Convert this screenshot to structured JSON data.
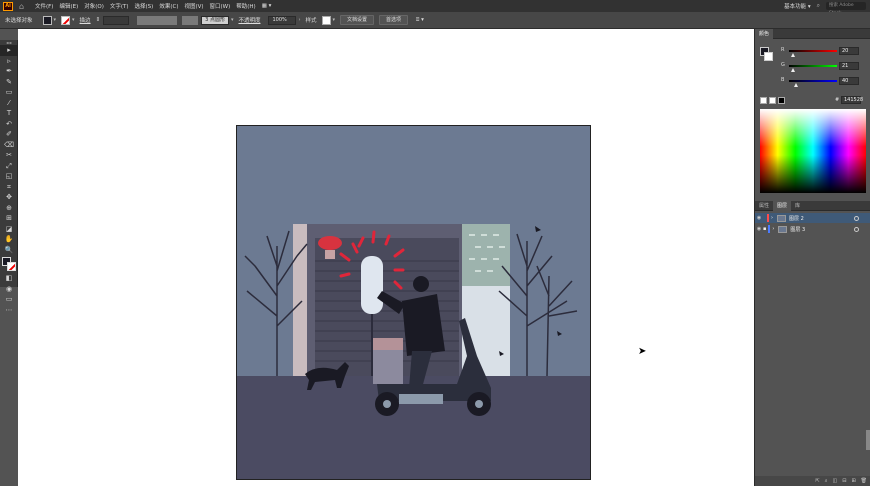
{
  "app": {
    "logo": "Ai",
    "home_icon": "home-icon"
  },
  "menu": {
    "items": [
      "文件(F)",
      "编辑(E)",
      "对象(O)",
      "文字(T)",
      "选择(S)",
      "效果(C)",
      "视图(V)",
      "窗口(W)",
      "帮助(H)",
      "▦ ▾"
    ],
    "workspace": "基本功能 ▾",
    "search_placeholder": "搜索 Adobe Stock"
  },
  "control_bar": {
    "selection_label": "未选择对象",
    "stroke_label": "描边",
    "brush_value": "3 点圆形",
    "opacity_label": "不透明度",
    "opacity_value": "100%",
    "style_label": "样式",
    "doc_setup_button": "文档设置",
    "preferences_button": "首选项"
  },
  "tools": [
    "▸",
    "▹",
    "✒",
    "✎",
    "▭",
    "⁄",
    "T",
    "↶",
    "✐",
    "⌫",
    "✂",
    "⤢",
    "◱",
    "⌗",
    "✥",
    "⊕",
    "⊞",
    "◪",
    "✋",
    "🔍"
  ],
  "color_panel": {
    "tab": "颜色",
    "channels": [
      {
        "name": "R",
        "value": "20",
        "gradient": "linear-gradient(to right,#000,#f00)",
        "fraction": 0.078
      },
      {
        "name": "G",
        "value": "21",
        "gradient": "linear-gradient(to right,#000,#0f0)",
        "fraction": 0.082
      },
      {
        "name": "B",
        "value": "40",
        "gradient": "linear-gradient(to right,#000,#00f)",
        "fraction": 0.157
      }
    ],
    "hex_label": "#",
    "hex_value": "141528"
  },
  "layers_panel": {
    "tabs": [
      "属性",
      "图层",
      "库"
    ],
    "active_tab": 1,
    "layers": [
      {
        "name": "图层 2",
        "color": "#ff4c4c",
        "selected": true
      },
      {
        "name": "图层 3",
        "color": "#4c7cff",
        "selected": false
      }
    ]
  },
  "artwork": {
    "sky_color": "#6c7a92",
    "ground_color": "#4b4b62",
    "shutter_color": "#4a4a5c",
    "building_color": "#5e5e72",
    "signal_color": "#e0263a",
    "lamp_color": "#dfe6ef",
    "rider_color": "#1a1a24",
    "scooter_color": "#2b2e3c"
  }
}
